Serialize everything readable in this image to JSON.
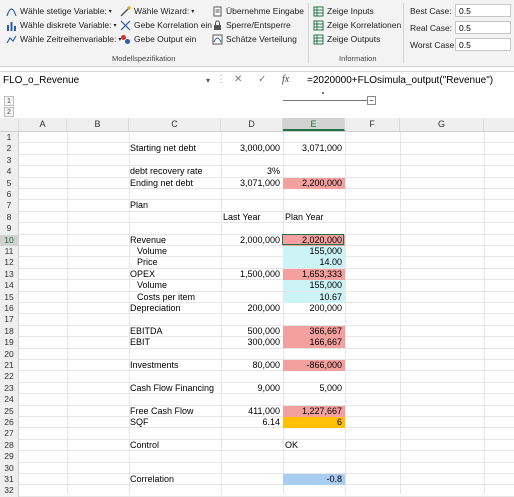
{
  "ribbon": {
    "group1": {
      "items": [
        "Wähle stetige Variable:",
        "Wähle diskrete Variable:",
        "Wähle Zeitreihenvariable:"
      ],
      "items2": [
        "Wähle Wizard:",
        "Gebe Korrelation ein",
        "Gebe Output ein"
      ],
      "items3": [
        "Übernehme Eingabe",
        "Sperre/Entsperre",
        "Schätze Verteilung"
      ],
      "label": "Modellspezifikation"
    },
    "group2": {
      "items": [
        "Zeige Inputs",
        "Zeige Korrelationen",
        "Zeige Outputs"
      ],
      "label": "Information"
    },
    "cases": [
      {
        "label": "Best Case:",
        "value": "0.5"
      },
      {
        "label": "Real Case:",
        "value": "0.5"
      },
      {
        "label": "Worst Case:",
        "value": "0.5"
      }
    ]
  },
  "formula_bar": {
    "name_box": "FLO_o_Revenue",
    "formula": "=2020000+FLOsimula_output(\"Revenue\")",
    "fx": "fx",
    "cancel": "✕",
    "enter": "✓"
  },
  "outline_levels": [
    "1",
    "2"
  ],
  "outline_collapse": "−",
  "columns": [
    "A",
    "B",
    "C",
    "D",
    "E",
    "F",
    "G"
  ],
  "active_column": "E",
  "active_row": 10,
  "rows": [
    "1",
    "2",
    "3",
    "4",
    "5",
    "6",
    "7",
    "8",
    "9",
    "10",
    "11",
    "12",
    "13",
    "14",
    "15",
    "16",
    "17",
    "18",
    "19",
    "20",
    "21",
    "22",
    "23",
    "24",
    "25",
    "26",
    "27",
    "28",
    "29",
    "30",
    "31",
    "32"
  ],
  "cells": {
    "c2": "Starting net debt",
    "d2": "3,000,000",
    "e2": "3,071,000",
    "c4": "debt recovery rate",
    "d4": "3%",
    "c5": "Ending net debt",
    "d5": "3,071,000",
    "e5": "2,200,000",
    "c7": "Plan",
    "d8": "Last Year",
    "e8": "Plan Year",
    "c10": "Revenue",
    "d10": "2,000,000",
    "e10": "2,020,000",
    "c11": "Volume",
    "e11": "155,000",
    "c12": "Price",
    "e12": "14.00",
    "c13": "OPEX",
    "d13": "1,500,000",
    "e13": "1,653,333",
    "c14": "Volume",
    "e14": "155,000",
    "c15": "Costs per item",
    "e15": "10.67",
    "c16": "Depreciation",
    "d16": "200,000",
    "e16": "200,000",
    "c18": "EBITDA",
    "d18": "500,000",
    "e18": "366,667",
    "c19": "EBIT",
    "d19": "300,000",
    "e19": "166,667",
    "c21": "Investments",
    "d21": "80,000",
    "e21": "-866,000",
    "c23": "Cash Flow Financing",
    "d23": "9,000",
    "e23": "5,000",
    "c25": "Free Cash Flow",
    "d25": "411,000",
    "e25": "1,227,667",
    "c26": "SQF",
    "d26": "6.14",
    "e26": "6",
    "c28": "Control",
    "e28": "OK",
    "c31": "Correlation",
    "e31": "-0.8"
  },
  "colors": {
    "output_fill": "#f4a09f",
    "input_fill": "#ccf3f5",
    "sqf_fill": "#ffc000",
    "correlation_fill": "#a9cdf1",
    "accent": "#217346"
  }
}
